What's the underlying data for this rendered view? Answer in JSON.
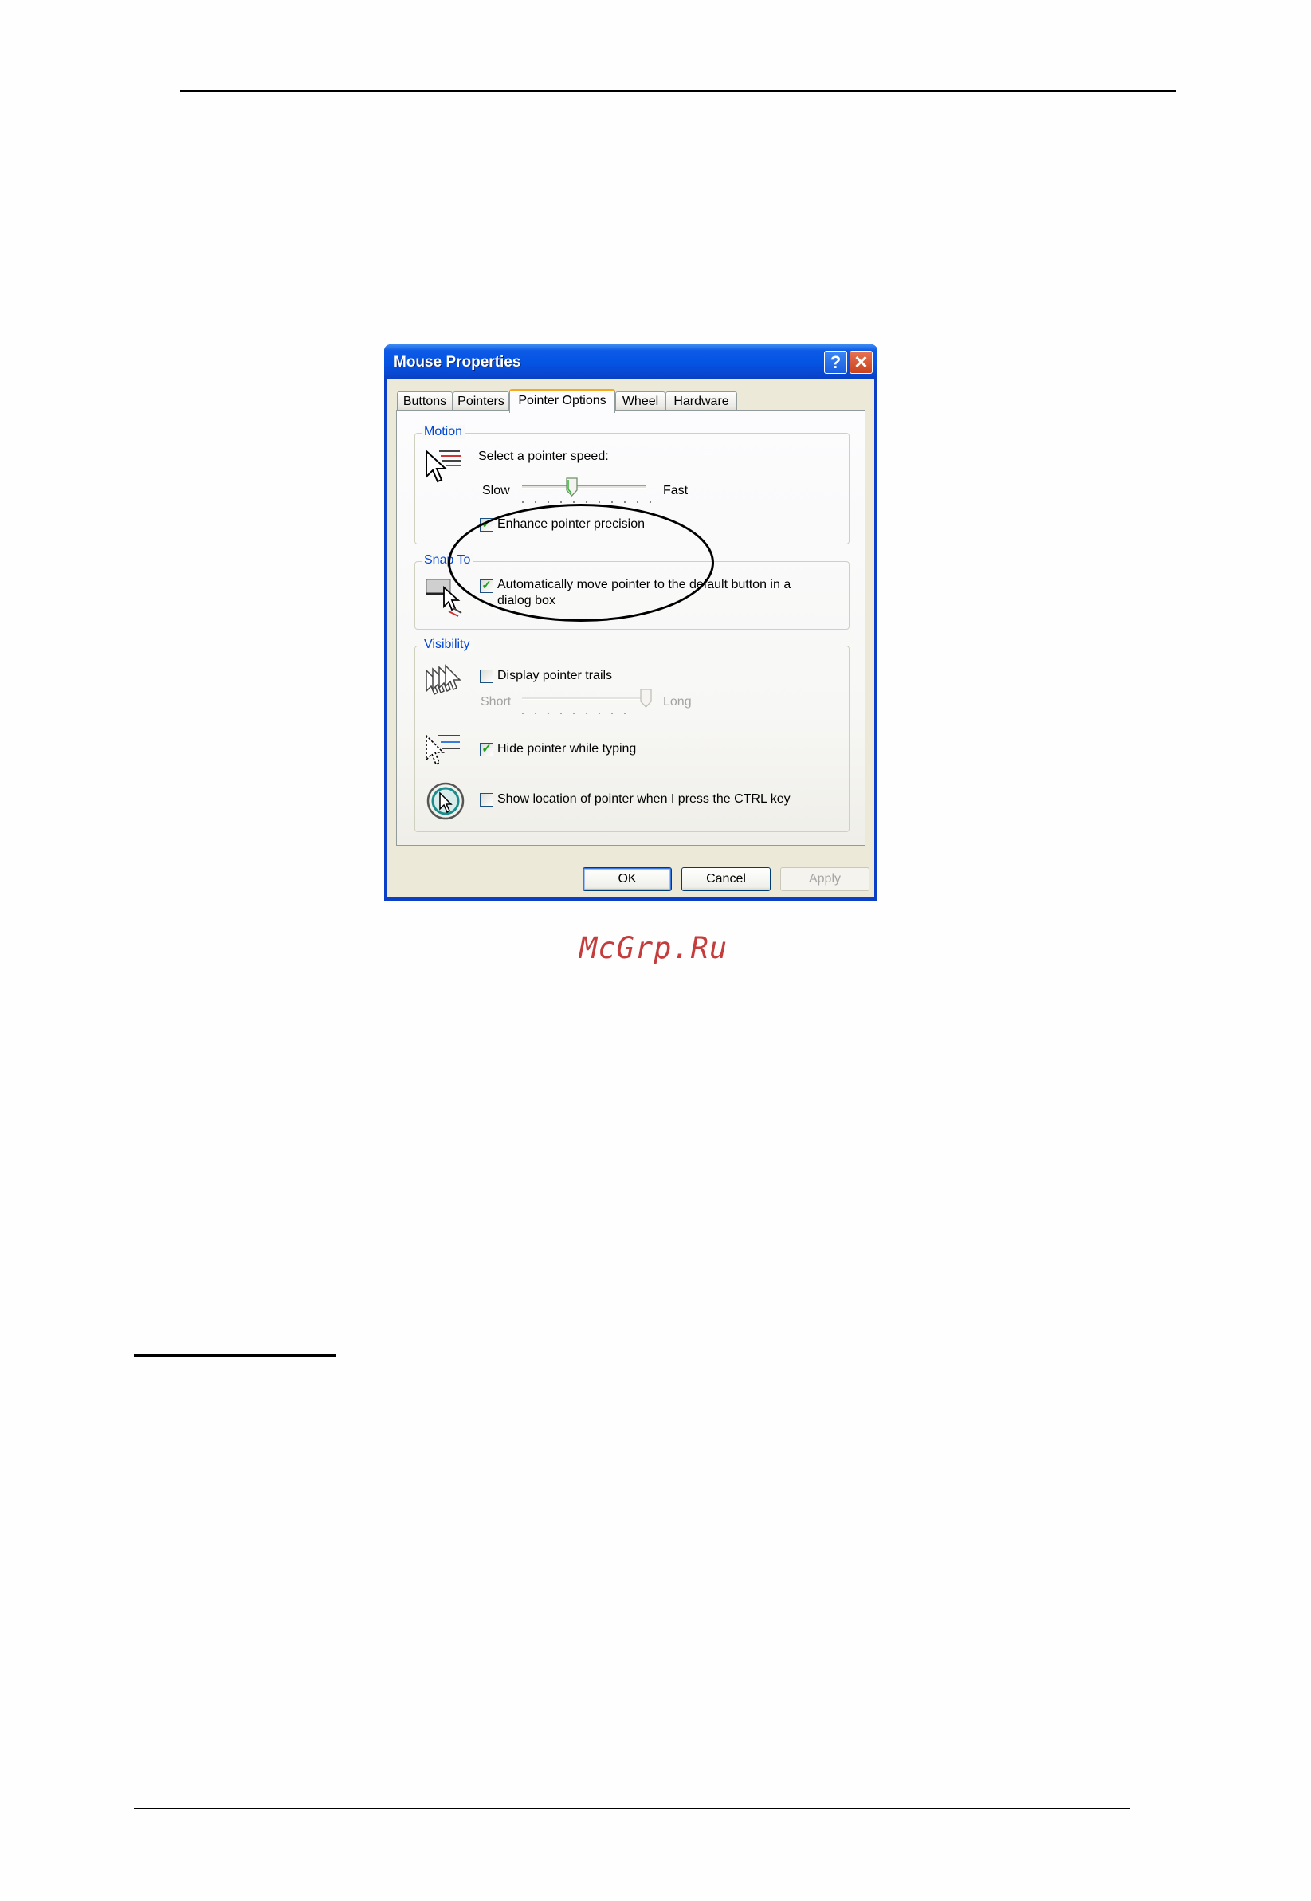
{
  "dialog": {
    "title": "Mouse Properties",
    "help_glyph": "?",
    "close_glyph": "✕",
    "tabs": [
      {
        "label": "Buttons"
      },
      {
        "label": "Pointers"
      },
      {
        "label": "Pointer Options",
        "active": true
      },
      {
        "label": "Wheel"
      },
      {
        "label": "Hardware"
      }
    ],
    "motion": {
      "title": "Motion",
      "speed_label": "Select a pointer speed:",
      "slow_label": "Slow",
      "fast_label": "Fast",
      "speed_fraction": 0.4,
      "enhance_label": "Enhance pointer precision",
      "enhance_checked": true
    },
    "snap_to": {
      "title": "Snap To",
      "auto_move_label_line1": "Automatically move pointer to the default button in a",
      "auto_move_label_line2": "dialog box",
      "auto_move_checked": true
    },
    "visibility": {
      "title": "Visibility",
      "trails_label": "Display pointer trails",
      "trails_checked": false,
      "short_label": "Short",
      "long_label": "Long",
      "trail_fraction": 1.0,
      "hide_label": "Hide pointer while typing",
      "hide_checked": true,
      "ctrl_label": "Show location of pointer when I press the CTRL key",
      "ctrl_checked": false
    },
    "buttons": {
      "ok": "OK",
      "cancel": "Cancel",
      "apply": "Apply"
    },
    "check_glyph": "✓"
  },
  "watermark": "McGrp.Ru",
  "colors": {
    "titlebar": "#0553e2",
    "group_title": "#0046d5",
    "watermark": "#c43c3c"
  }
}
